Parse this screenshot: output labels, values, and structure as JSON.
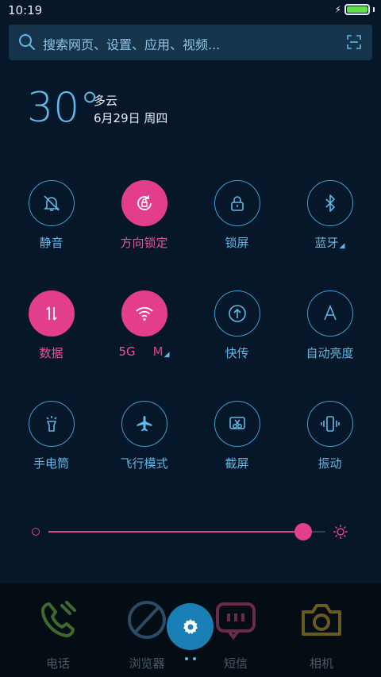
{
  "status_bar": {
    "time": "10:19",
    "battery_level": 1.0
  },
  "search": {
    "placeholder": "搜索网页、设置、应用、视频..."
  },
  "weather": {
    "temperature": "30°",
    "condition": "多云",
    "date": "6月29日 周四"
  },
  "toggles": [
    {
      "id": "mute",
      "label": "静音",
      "icon": "bell-off-icon",
      "active": false
    },
    {
      "id": "rotation-lock",
      "label": "方向锁定",
      "icon": "rotation-lock-icon",
      "active": true
    },
    {
      "id": "lock-screen",
      "label": "锁屏",
      "icon": "lock-icon",
      "active": false
    },
    {
      "id": "bluetooth",
      "label": "蓝牙",
      "icon": "bluetooth-icon",
      "active": false,
      "has_menu": true
    },
    {
      "id": "mobile-data",
      "label": "数据",
      "icon": "data-arrows-icon",
      "active": true
    },
    {
      "id": "wifi",
      "label": "5G",
      "label_suffix": "M",
      "icon": "wifi-icon",
      "active": true,
      "has_menu": true
    },
    {
      "id": "quick-transfer",
      "label": "快传",
      "icon": "upload-icon",
      "active": false
    },
    {
      "id": "auto-brightness",
      "label": "自动亮度",
      "icon": "letter-a-icon",
      "active": false
    },
    {
      "id": "flashlight",
      "label": "手电筒",
      "icon": "flashlight-icon",
      "active": false
    },
    {
      "id": "airplane-mode",
      "label": "飞行模式",
      "icon": "airplane-icon",
      "active": false
    },
    {
      "id": "screenshot",
      "label": "截屏",
      "icon": "scissors-icon",
      "active": false
    },
    {
      "id": "vibrate",
      "label": "振动",
      "icon": "vibrate-icon",
      "active": false
    }
  ],
  "brightness": {
    "level": 0.92
  },
  "dock": [
    {
      "label": "电话",
      "icon": "phone-icon",
      "color": "#3d6b2e"
    },
    {
      "label": "浏览器",
      "icon": "browser-icon",
      "color": "#2a4a66"
    },
    {
      "label": "短信",
      "icon": "message-icon",
      "color": "#6a2a4a"
    },
    {
      "label": "相机",
      "icon": "camera-icon",
      "color": "#6a5a1e"
    }
  ],
  "colors": {
    "accent": "#e23e8d",
    "primary": "#5fb8e6",
    "background": "#06172a",
    "fab": "#1a7fb4"
  }
}
